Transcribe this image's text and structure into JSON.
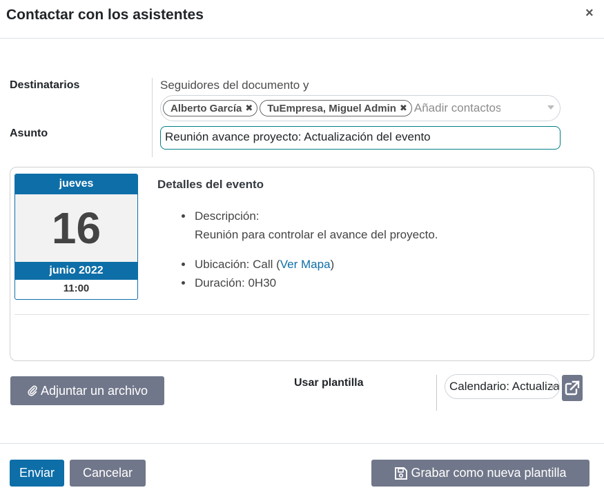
{
  "dialog": {
    "title": "Contactar con los asistentes",
    "close_icon": "×"
  },
  "form": {
    "recipients_label": "Destinatarios",
    "followers_text": "Seguidores del documento y",
    "tags": [
      {
        "label": "Alberto García",
        "remove": "✖"
      },
      {
        "label": "TuEmpresa, Miguel Admin",
        "remove": "✖"
      }
    ],
    "add_contact_placeholder": "Añadir contactos",
    "subject_label": "Asunto",
    "subject_value": "Reunión avance proyecto: Actualización del evento"
  },
  "calendar": {
    "weekday": "jueves",
    "day": "16",
    "month_year": "junio 2022",
    "time": "11:00"
  },
  "details": {
    "title": "Detalles del evento",
    "description_label": "Descripción:",
    "description_text": "Reunión para controlar el avance del proyecto.",
    "location_prefix": "Ubicación: Call (",
    "map_link": "Ver Mapa",
    "location_suffix": ")",
    "duration": "Duración: 0H30"
  },
  "attachments": {
    "attach_label": "Adjuntar un archivo",
    "attach_icon": "paperclip-icon"
  },
  "template": {
    "label": "Usar plantilla",
    "selected": "Calendario: Actualización del evento",
    "external_icon": "external-link-icon"
  },
  "footer": {
    "send_label": "Enviar",
    "cancel_label": "Cancelar",
    "save_template_label": "Grabar como nueva plantilla",
    "save_icon": "floppy-disk-icon"
  },
  "colors": {
    "primary": "#0e6ea8",
    "secondary_button": "#71778a",
    "focus_border": "#017e84"
  }
}
